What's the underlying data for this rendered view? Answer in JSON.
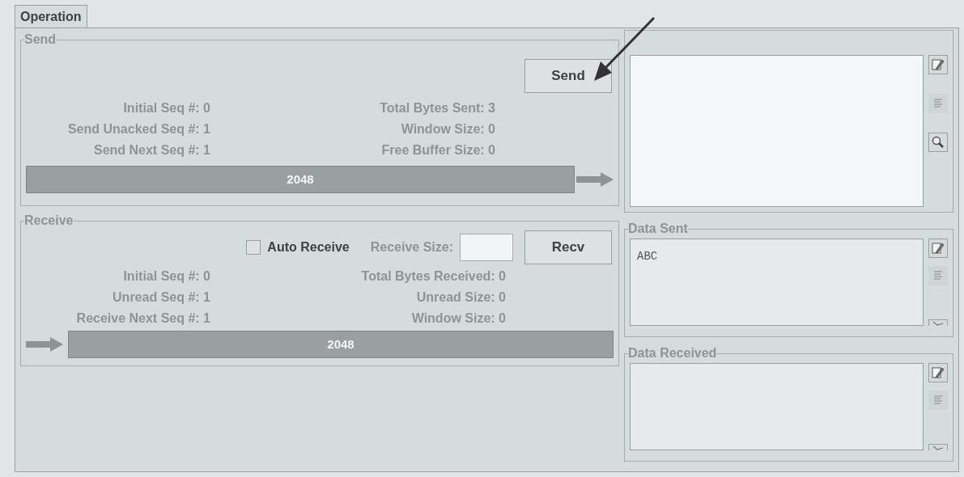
{
  "tab": {
    "label": "Operation",
    "selected": true
  },
  "send": {
    "title": "Send",
    "button": "Send",
    "stats_left": [
      "Initial Seq #: 0",
      "Send Unacked Seq #: 1",
      "Send Next Seq #: 1"
    ],
    "stats_right": [
      "Total Bytes Sent: 3",
      "Window Size: 0",
      "Free Buffer Size: 0"
    ],
    "buffer": "2048"
  },
  "receive": {
    "title": "Receive",
    "auto_receive": {
      "label": "Auto Receive",
      "checked": false
    },
    "receive_size_label": "Receive Size:",
    "button": "Recv",
    "stats_left": [
      "Initial Seq #: 0",
      "Unread Seq #: 1",
      "Receive Next Seq #: 1"
    ],
    "stats_right": [
      "Total Bytes Received: 0",
      "Unread Size: 0",
      "Window Size: 0"
    ],
    "buffer": "2048"
  },
  "data_sent": {
    "title": "Data Sent",
    "value": "ABC"
  },
  "data_received": {
    "title": "Data Received"
  }
}
